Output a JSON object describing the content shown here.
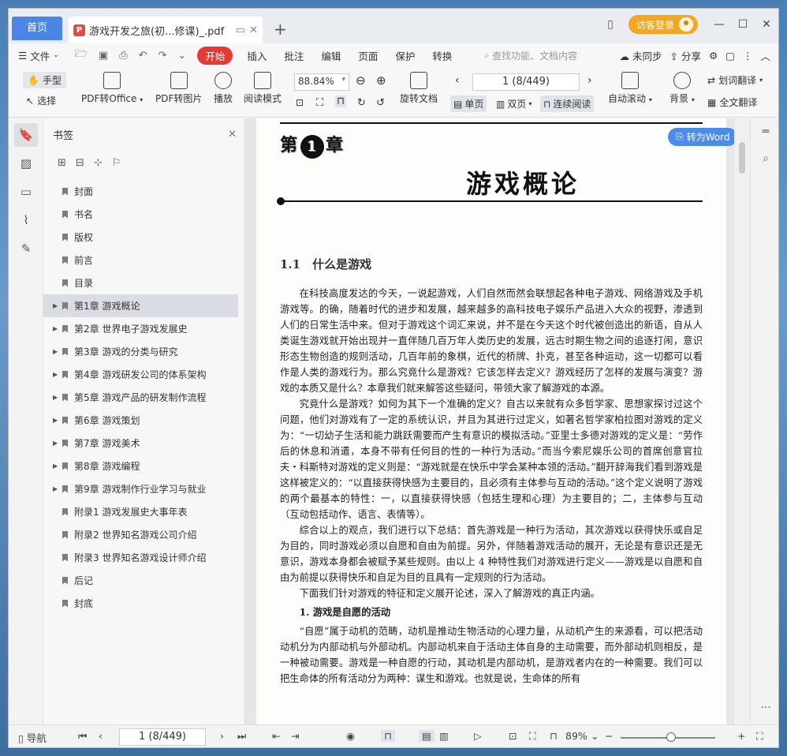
{
  "tabs": {
    "home": "首页",
    "document": "游戏开发之旅(初...修课)_.pdf",
    "new_tab": "+"
  },
  "titlebar": {
    "login": "访客登录"
  },
  "menu": {
    "file": "文件",
    "items": [
      "开始",
      "插入",
      "批注",
      "编辑",
      "页面",
      "保护",
      "转换"
    ],
    "search_placeholder": "查找功能、文档内容",
    "sync": "未同步",
    "share": "分享"
  },
  "ribbon": {
    "hand": "手型",
    "select": "选择",
    "pdf_to_office": "PDF转Office",
    "pdf_to_image": "PDF转图片",
    "play": "播放",
    "read_mode": "阅读模式",
    "zoom": "88.84%",
    "rotate": "旋转文档",
    "page": "1 (8/449)",
    "single": "单页",
    "double": "双页",
    "continuous": "连续阅读",
    "auto_scroll": "自动滚动",
    "background": "背景",
    "word_translate": "划词翻译",
    "full_translate": "全文翻译"
  },
  "bookmarks": {
    "title": "书签",
    "items": [
      {
        "label": "封面",
        "expandable": false
      },
      {
        "label": "书名",
        "expandable": false
      },
      {
        "label": "版权",
        "expandable": false
      },
      {
        "label": "前言",
        "expandable": false
      },
      {
        "label": "目录",
        "expandable": false
      },
      {
        "label": "第1章 游戏概论",
        "expandable": true,
        "active": true
      },
      {
        "label": "第2章 世界电子游戏发展史",
        "expandable": true
      },
      {
        "label": "第3章 游戏的分类与研究",
        "expandable": true
      },
      {
        "label": "第4章 游戏研发公司的体系架构",
        "expandable": true
      },
      {
        "label": "第5章 游戏产品的研发制作流程",
        "expandable": true
      },
      {
        "label": "第6章 游戏策划",
        "expandable": true
      },
      {
        "label": "第7章 游戏美术",
        "expandable": true
      },
      {
        "label": "第8章 游戏编程",
        "expandable": true
      },
      {
        "label": "第9章 游戏制作行业学习与就业",
        "expandable": true
      },
      {
        "label": "附录1 游戏发展史大事年表",
        "expandable": false
      },
      {
        "label": "附录2 世界知名游戏公司介绍",
        "expandable": false
      },
      {
        "label": "附录3 世界知名游戏设计师介绍",
        "expandable": false
      },
      {
        "label": "后记",
        "expandable": false
      },
      {
        "label": "封底",
        "expandable": false
      }
    ]
  },
  "document": {
    "chapter_prefix": "第",
    "chapter_num": "1",
    "chapter_suffix": "章",
    "chapter_title": "游戏概论",
    "section_title": "1.1　什么是游戏",
    "paragraphs": [
      "在科技高度发达的今天，一说起游戏，人们自然而然会联想起各种电子游戏、网络游戏及手机游戏等。的确，随着时代的进步和发展，越来越多的高科技电子娱乐产品进入大众的视野，渗透到人们的日常生活中来。但对于游戏这个词汇来说，并不是在今天这个时代被创造出的新语，自从人类诞生游戏就开始出现并一直伴随几百万年人类历史的发展，远古时期生物之间的追逐打闹，意识形态生物创造的规则活动，几百年前的象棋，近代的桥牌、扑克，甚至各种运动，这一切都可以看作是人类的游戏行为。那么究竟什么是游戏？它该怎样去定义？游戏经历了怎样的发展与演变？游戏的本质又是什么？本章我们就来解答这些疑问，带领大家了解游戏的本源。",
      "究竟什么是游戏？如何为其下一个准确的定义？自古以来就有众多哲学家、思想家探讨过这个问题，他们对游戏有了一定的系统认识，并且为其进行过定义，如著名哲学家柏拉图对游戏的定义为：“一切幼子生活和能力跳跃需要而产生有意识的模拟活动。”亚里士多德对游戏的定义是：“劳作后的休息和消遣，本身不带有任何目的性的一种行为活动。”而当今索尼娱乐公司的首席创意官拉夫・科斯特对游戏的定义则是：“游戏就是在快乐中学会某种本领的活动。”翻开辞海我们看到游戏是这样被定义的：“以直接获得快感为主要目的，且必须有主体参与互动的活动。”这个定义说明了游戏的两个最基本的特性：一，以直接获得快感（包括生理和心理）为主要目的；二，主体参与互动（互动包括动作、语言、表情等）。",
      "综合以上的观点，我们进行以下总结：首先游戏是一种行为活动，其次游戏以获得快乐或自足为目的，同时游戏必须以自愿和自由为前提。另外，伴随着游戏活动的展开，无论是有意识还是无意识，游戏本身都会被赋予某些规则。由以上 4 种特性我们对游戏进行定义——游戏是以自愿和自由为前提以获得快乐和自足为目的且具有一定规则的行为活动。",
      "下面我们针对游戏的特征和定义展开论述，深入了解游戏的真正内涵。"
    ],
    "subheading": "1. 游戏是自愿的活动",
    "paragraph_after": "“自愿”属于动机的范畴，动机是推动生物活动的心理力量，从动机产生的来源看，可以把活动动机分为内部动机与外部动机。内部动机来自于活动主体自身的主动需要，而外部动机则相反，是一种被动需要。游戏是一种自愿的行动，其动机是内部动机，是游戏者内在的一种需要。我们可以把生命体的所有活动分为两种：谋生和游戏。也就是说，生命体的所有",
    "to_word": "转为Word"
  },
  "statusbar": {
    "nav": "导航",
    "page": "1 (8/449)",
    "zoom": "89%"
  }
}
